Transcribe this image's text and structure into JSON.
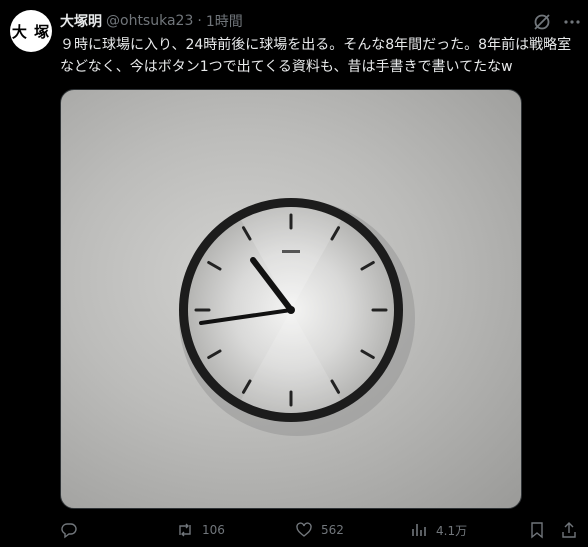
{
  "tweet": {
    "avatar_text": "大 塚",
    "display_name": "大塚明",
    "handle": "@ohtsuka23",
    "separator": "·",
    "time": "1時間",
    "text": "９時に球場に入り、24時前後に球場を出る。そんな8年間だった。8年前は戦略室などなく、今はボタン1つで出てくる資料も、昔は手書きで書いてたなw"
  },
  "icons": {
    "grok": "grok-icon",
    "more": "more-icon",
    "reply": "reply-icon",
    "retweet": "retweet-icon",
    "like": "like-icon",
    "views": "views-icon",
    "bookmark": "bookmark-icon",
    "share": "share-icon"
  },
  "actions": {
    "reply_count": "",
    "retweet_count": "106",
    "like_count": "562",
    "views_count": "4.1万"
  },
  "colors": {
    "background": "#000000",
    "text": "#e7e9ea",
    "muted": "#71767b"
  }
}
